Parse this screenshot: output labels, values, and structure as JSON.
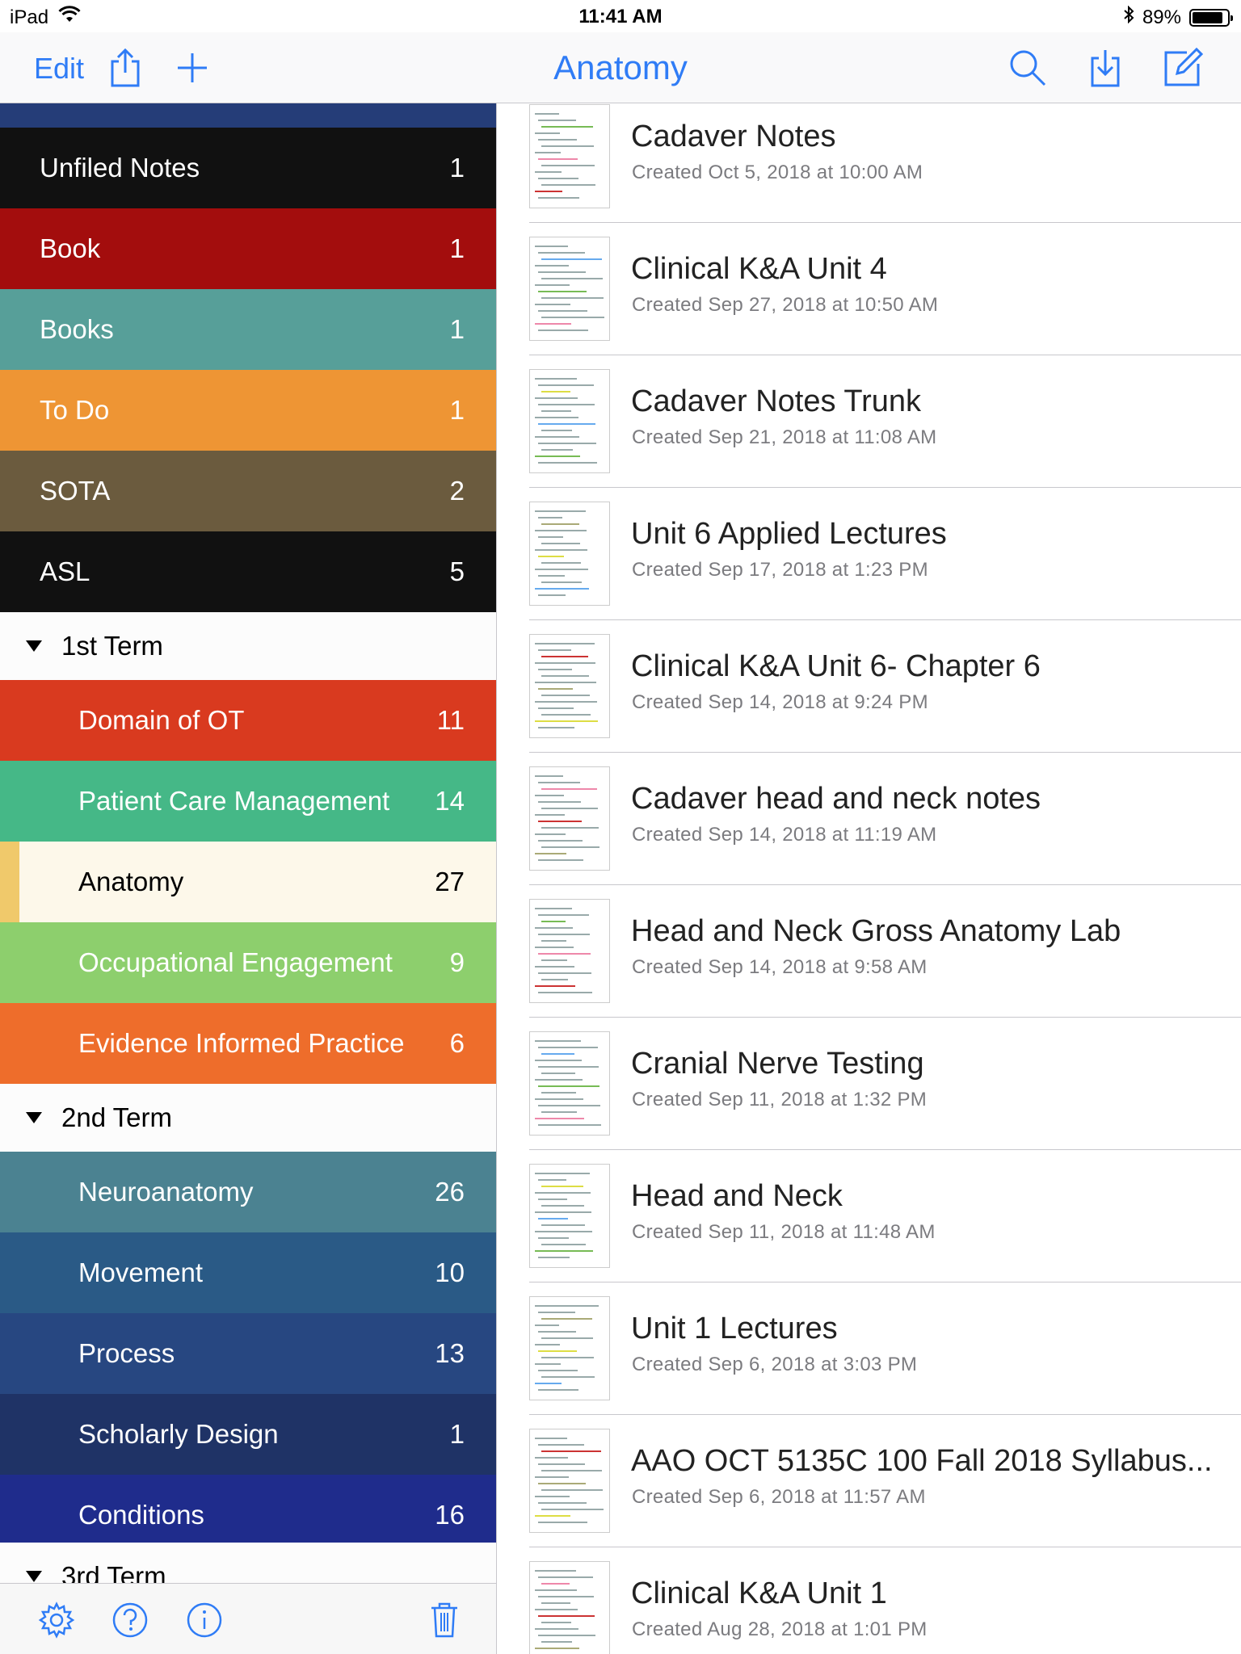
{
  "status_bar": {
    "device": "iPad",
    "time": "11:41 AM",
    "battery": "89%",
    "battery_level": 0.89,
    "icons": [
      "wifi-icon",
      "bluetooth-icon",
      "battery-icon"
    ]
  },
  "navbar": {
    "edit_label": "Edit",
    "title": "Anatomy",
    "accent_color": "#2f7cf6"
  },
  "sidebar": {
    "top_items": [
      {
        "label": "Unfiled Notes",
        "count": "1",
        "color": "#111111"
      },
      {
        "label": "Book",
        "count": "1",
        "color": "#a30d0d"
      },
      {
        "label": "Books",
        "count": "1",
        "color": "#579f99"
      },
      {
        "label": "To Do",
        "count": "1",
        "color": "#ee9534"
      },
      {
        "label": "SOTA",
        "count": "2",
        "color": "#6b5b3e"
      },
      {
        "label": "ASL",
        "count": "5",
        "color": "#111111"
      }
    ],
    "sections": [
      {
        "label": "1st Term",
        "items": [
          {
            "label": "Domain of OT",
            "count": "11",
            "color": "#d93a1f"
          },
          {
            "label": "Patient Care Management",
            "count": "14",
            "color": "#45b887"
          },
          {
            "label": "Anatomy",
            "count": "27",
            "color": "#fdf8ea",
            "selected": true
          },
          {
            "label": "Occupational Engagement",
            "count": "9",
            "color": "#8dcf6d"
          },
          {
            "label": "Evidence Informed Practice",
            "count": "6",
            "color": "#ee6d2b"
          }
        ]
      },
      {
        "label": "2nd Term",
        "items": [
          {
            "label": "Neuroanatomy",
            "count": "26",
            "color": "#4b8291"
          },
          {
            "label": "Movement",
            "count": "10",
            "color": "#2a5a86"
          },
          {
            "label": "Process",
            "count": "13",
            "color": "#274781"
          },
          {
            "label": "Scholarly Design",
            "count": "1",
            "color": "#1f3366"
          },
          {
            "label": "Conditions",
            "count": "16",
            "color": "#1f2c8c"
          }
        ]
      }
    ],
    "partial_section_label": "3rd Term"
  },
  "notes": [
    {
      "title": "Cadaver Notes",
      "date": "Created Oct 5, 2018 at 10:00 AM"
    },
    {
      "title": "Clinical K&A Unit 4",
      "date": "Created Sep 27, 2018 at 10:50 AM"
    },
    {
      "title": "Cadaver Notes Trunk",
      "date": "Created Sep 21, 2018 at 11:08 AM"
    },
    {
      "title": "Unit 6 Applied Lectures",
      "date": "Created Sep 17, 2018 at 1:23 PM"
    },
    {
      "title": "Clinical K&A Unit 6- Chapter 6",
      "date": "Created Sep 14, 2018 at 9:24 PM"
    },
    {
      "title": "Cadaver head and neck notes",
      "date": "Created Sep 14, 2018 at 11:19 AM"
    },
    {
      "title": "Head and Neck Gross Anatomy Lab",
      "date": "Created Sep 14, 2018 at 9:58 AM"
    },
    {
      "title": "Cranial Nerve Testing",
      "date": "Created Sep 11, 2018 at 1:32 PM"
    },
    {
      "title": "Head and Neck",
      "date": "Created Sep 11, 2018 at 11:48 AM"
    },
    {
      "title": "Unit 1 Lectures",
      "date": "Created Sep 6, 2018 at 3:03 PM"
    },
    {
      "title": "AAO OCT 5135C 100 Fall 2018 Syllabus...",
      "date": "Created Sep 6, 2018 at 11:57 AM"
    },
    {
      "title": "Clinical K&A Unit 1",
      "date": "Created Aug 28, 2018 at 1:01 PM"
    }
  ]
}
